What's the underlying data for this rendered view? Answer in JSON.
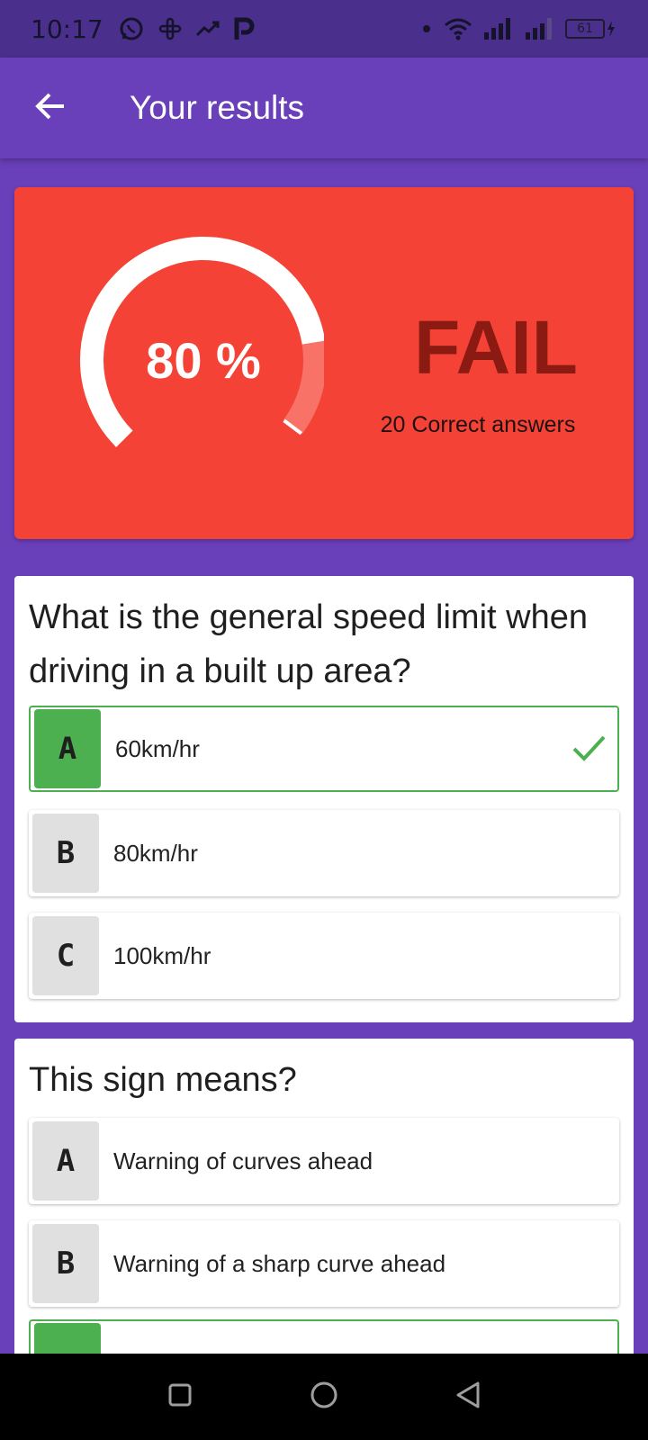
{
  "status_bar": {
    "time": "10:17",
    "left_icons": [
      "whatsapp-icon",
      "slack-icon",
      "trending-icon",
      "pocket-icon"
    ],
    "right_icons": [
      "dot-icon",
      "wifi-icon",
      "signal-icon",
      "signal-icon",
      "battery-icon"
    ],
    "battery_level": "61"
  },
  "app_bar": {
    "title": "Your results",
    "back_icon": "arrow-left-icon"
  },
  "result": {
    "percent_text": "80 %",
    "percent_value": 0.8,
    "status": "FAIL",
    "correct_answers": "20 Correct answers",
    "colors": {
      "card": "#f44336",
      "status": "#8b1a12",
      "arc": "#ffffff",
      "arc_remaining": "#f87267"
    }
  },
  "questions": [
    {
      "text": "What is the general speed limit when driving in a built up area?",
      "options": [
        {
          "letter": "A",
          "text": "60km/hr",
          "correct": true
        },
        {
          "letter": "B",
          "text": "80km/hr",
          "correct": false
        },
        {
          "letter": "C",
          "text": "100km/hr",
          "correct": false
        }
      ]
    },
    {
      "text": "This sign means?",
      "options": [
        {
          "letter": "A",
          "text": "Warning of curves ahead",
          "correct": false
        },
        {
          "letter": "B",
          "text": "Warning of a sharp curve ahead",
          "correct": false
        },
        {
          "letter": "",
          "text": "",
          "correct": true
        }
      ]
    }
  ],
  "nav_bar": {
    "buttons": [
      "recents-square-icon",
      "home-circle-icon",
      "back-triangle-icon"
    ]
  },
  "colors": {
    "primary": "#6a3fba",
    "status_bar": "#4a2f8c",
    "correct": "#4caf50"
  }
}
